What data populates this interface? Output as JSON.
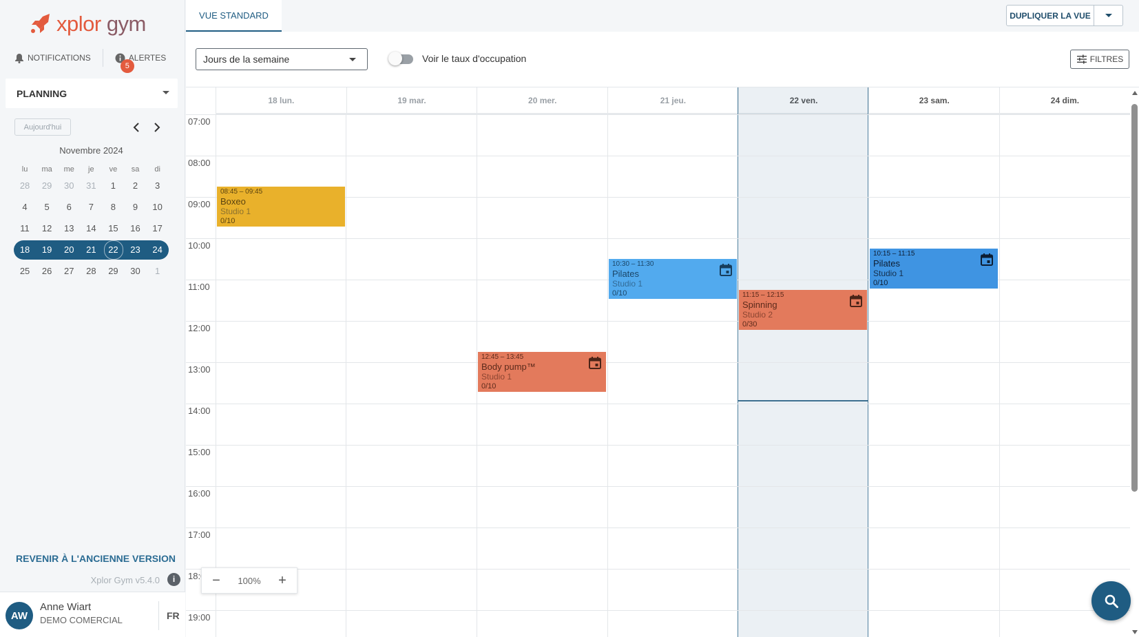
{
  "brand": {
    "logo_text_a": "xplor",
    "logo_text_b": " gym",
    "accent": "#e35b3e",
    "primary": "#1f5c82"
  },
  "topnav": {
    "notifications": "NOTIFICATIONS",
    "alerts": "ALERTES",
    "alerts_count": "5"
  },
  "sidebar": {
    "planning": "PLANNING",
    "today_button": "Aujourd'hui",
    "month": "Novembre 2024",
    "weekdays": [
      "lu",
      "ma",
      "me",
      "je",
      "ve",
      "sa",
      "di"
    ],
    "weeks": [
      [
        "28",
        "29",
        "30",
        "31",
        "1",
        "2",
        "3"
      ],
      [
        "4",
        "5",
        "6",
        "7",
        "8",
        "9",
        "10"
      ],
      [
        "11",
        "12",
        "13",
        "14",
        "15",
        "16",
        "17"
      ],
      [
        "18",
        "19",
        "20",
        "21",
        "22",
        "23",
        "24"
      ],
      [
        "25",
        "26",
        "27",
        "28",
        "29",
        "30",
        "1"
      ]
    ],
    "old_version": "REVENIR À L'ANCIENNE VERSION",
    "version": "Xplor Gym v5.4.0",
    "info_icon": "i"
  },
  "user": {
    "initials": "AW",
    "name": "Anne Wiart",
    "org": "DEMO COMERCIAL",
    "lang": "FR"
  },
  "tabs": {
    "standard": "VUE STANDARD",
    "duplicate": "DUPLIQUER LA VUE"
  },
  "toolbar": {
    "view_select": "Jours de la semaine",
    "occupancy_toggle": "Voir le taux d'occupation",
    "occupancy_on": false,
    "filters": "FILTRES"
  },
  "calendar": {
    "days": [
      "18 lun.",
      "19 mar.",
      "20 mer.",
      "21 jeu.",
      "22 ven.",
      "23 sam.",
      "24 dim."
    ],
    "hours": [
      "07:00",
      "08:00",
      "09:00",
      "10:00",
      "11:00",
      "12:00",
      "13:00",
      "14:00",
      "15:00",
      "16:00",
      "17:00",
      "18:00",
      "19:00"
    ],
    "events": [
      {
        "time": "08:45 – 09:45",
        "title": "Boxeo",
        "room": "Studio 1",
        "capacity": "0/10",
        "color": "#e9b12b",
        "icon": false
      },
      {
        "time": "12:45 – 13:45",
        "title": "Body pump™",
        "room": "Studio 1",
        "capacity": "0/10",
        "color": "#e37a5c",
        "icon": true
      },
      {
        "time": "10:30 – 11:30",
        "title": "Pilates",
        "room": "Studio 1",
        "capacity": "0/10",
        "color": "#52aaee",
        "icon": true
      },
      {
        "time": "11:15 – 12:15",
        "title": "Spinning",
        "room": "Studio 2",
        "capacity": "0/30",
        "color": "#e37a5c",
        "icon": true
      },
      {
        "time": "10:15 – 11:15",
        "title": "Pilates",
        "room": "Studio 1",
        "capacity": "0/10",
        "color": "#3f94e2",
        "icon": true
      }
    ]
  },
  "zoom": {
    "minus": "−",
    "value": "100%",
    "plus": "+"
  },
  "icons": {
    "search": "search-icon",
    "calendar": "calendar-icon",
    "bell": "bell-icon",
    "filters": "tune-icon"
  }
}
